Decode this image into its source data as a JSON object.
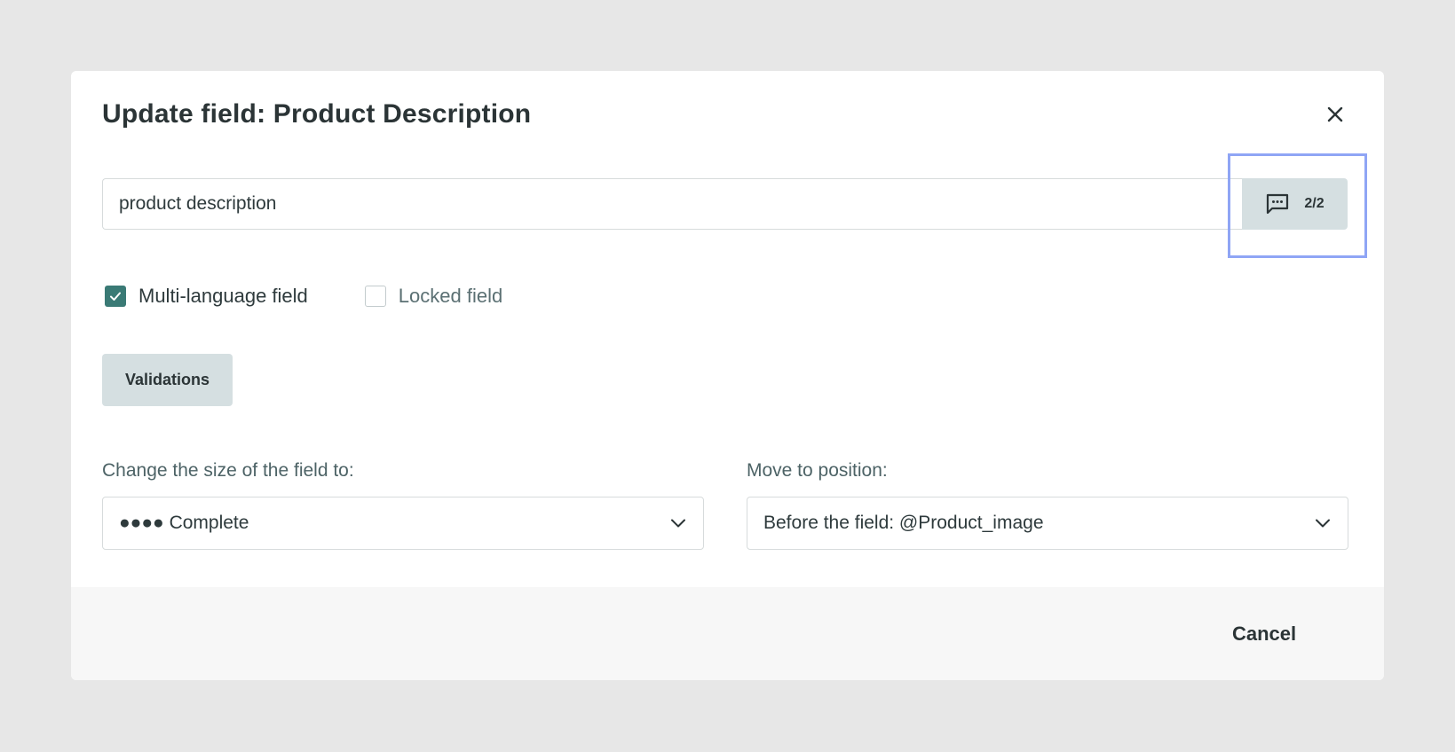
{
  "dialog": {
    "title": "Update field: Product Description",
    "close_icon": "close-icon"
  },
  "field_name": {
    "value": "product description",
    "translations_icon": "comment-dots-icon",
    "translations_count": "2/2"
  },
  "options": {
    "multi_language": {
      "label": "Multi-language field",
      "checked": true
    },
    "locked": {
      "label": "Locked field",
      "checked": false
    }
  },
  "validations": {
    "label": "Validations"
  },
  "size": {
    "label": "Change the size of the field to:",
    "selected": "●●●● Complete"
  },
  "position": {
    "label": "Move to position:",
    "selected": "Before the field: @Product_image"
  },
  "footer": {
    "cancel_label": "Cancel"
  },
  "colors": {
    "accent": "#3a7a75",
    "button_bg": "#d5dfe1",
    "highlight": "#8fa5f5",
    "footer_bg": "#f7f7f7",
    "backdrop": "#e7e7e7"
  }
}
